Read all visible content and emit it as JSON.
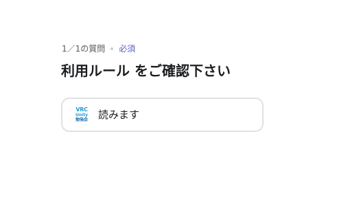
{
  "question": {
    "counter": "1／1の質問",
    "required_label": "必須",
    "title": "利用ルール をご確認下さい"
  },
  "options": [
    {
      "label": "読みます",
      "logo": {
        "line1": "VRC",
        "line2": "Unity",
        "line3": "勉強会"
      }
    }
  ],
  "colors": {
    "accent": "#5a5fc8",
    "logo_blue": "#1c9ad6",
    "border": "#dfe1e5",
    "text": "#1b1d21"
  }
}
